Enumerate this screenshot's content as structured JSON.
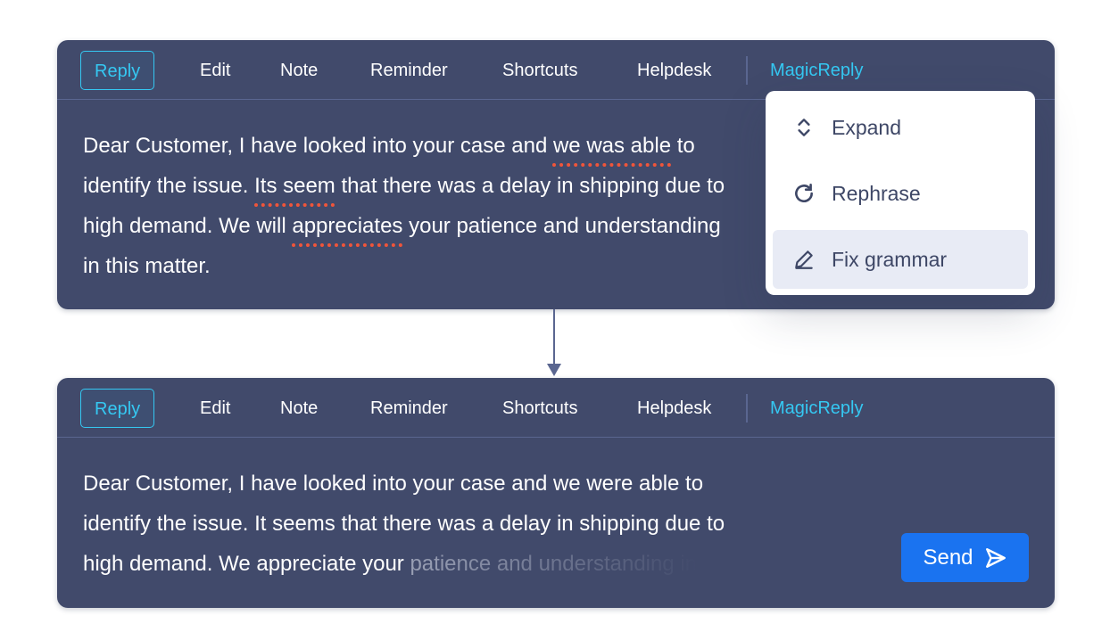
{
  "tabs": [
    "Reply",
    "Edit",
    "Note",
    "Reminder",
    "Shortcuts",
    "Helpdesk",
    "MagicReply"
  ],
  "before": {
    "line1": {
      "a": "Dear Customer, I have looked into your case and ",
      "err": "we was able",
      "b": " to"
    },
    "line2": {
      "a": "identify the issue. ",
      "err": "Its seem",
      "b": " that there was a delay in shipping due to"
    },
    "line3": {
      "a": "high demand. We will ",
      "err": "appreciates",
      "b": " your patience and understanding"
    },
    "line4": "in this matter."
  },
  "menu": {
    "items": [
      {
        "label": "Expand",
        "icon": "expand-icon"
      },
      {
        "label": "Rephrase",
        "icon": "refresh-icon"
      },
      {
        "label": "Fix grammar",
        "icon": "pencil-icon",
        "selected": true
      }
    ]
  },
  "after": {
    "line1": "Dear Customer, I have looked into your case and we were able to",
    "line2": "identify the issue. It seems that there was a delay in shipping due to",
    "line3": "high demand. We appreciate your ",
    "line3_fading": "patience and understanding in"
  },
  "send_label": "Send",
  "colors": {
    "panel": "#414a6b",
    "accent": "#35c8f2",
    "error": "#f0553a",
    "send": "#1a73f0"
  }
}
